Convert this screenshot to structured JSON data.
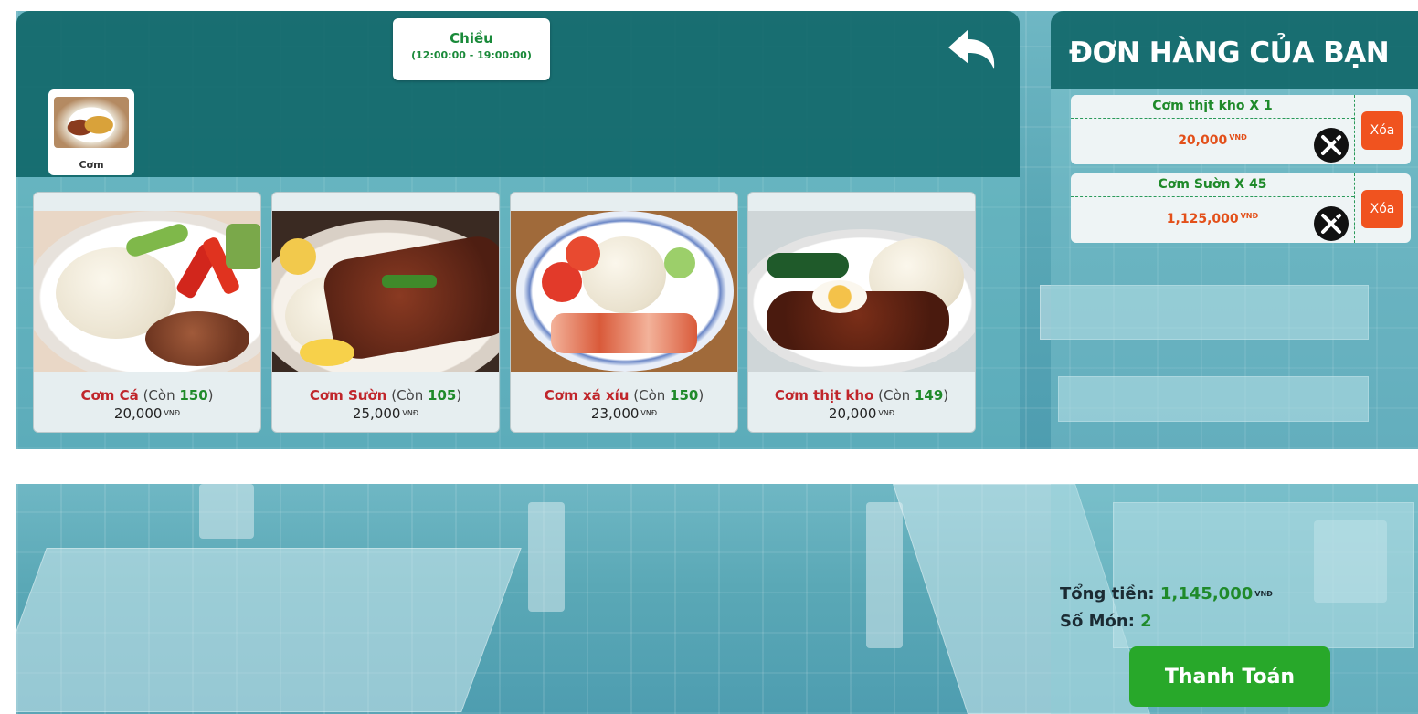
{
  "shift": {
    "name": "Chiều",
    "time": "(12:00:00 - 19:00:00)"
  },
  "category": {
    "label": "Cơm"
  },
  "currency": "VNĐ",
  "dishes": [
    {
      "name": "Cơm Cá",
      "stock_prefix": "(Còn ",
      "stock": "150",
      "stock_suffix": ")",
      "price": "20,000"
    },
    {
      "name": "Cơm Sườn",
      "stock_prefix": "(Còn ",
      "stock": "105",
      "stock_suffix": ")",
      "price": "25,000"
    },
    {
      "name": "Cơm xá xíu",
      "stock_prefix": "(Còn ",
      "stock": "150",
      "stock_suffix": ")",
      "price": "23,000"
    },
    {
      "name": "Cơm thịt kho",
      "stock_prefix": "(Còn ",
      "stock": "149",
      "stock_suffix": ")",
      "price": "20,000"
    }
  ],
  "order": {
    "title": "ĐƠN HÀNG CỦA BẠN",
    "items": [
      {
        "label": "Cơm thịt kho  X  1",
        "price": "20,000",
        "delete_label": "Xóa"
      },
      {
        "label": "Cơm Sườn  X  45",
        "price": "1,125,000",
        "delete_label": "Xóa"
      }
    ],
    "total_label": "Tổng tiền:",
    "total_value": "1,145,000",
    "count_label": "Số Món:",
    "count_value": "2",
    "pay_label": "Thanh Toán"
  },
  "colors": {
    "header_teal": "#11686a",
    "dish_name_red": "#c0262b",
    "stock_green": "#1f8a2a",
    "price_orange": "#e3501a",
    "delete_orange": "#f0531f",
    "pay_green": "#28a82a"
  },
  "icons": {
    "back": "back-arrow-icon",
    "cancel": "no-utensils-icon"
  }
}
